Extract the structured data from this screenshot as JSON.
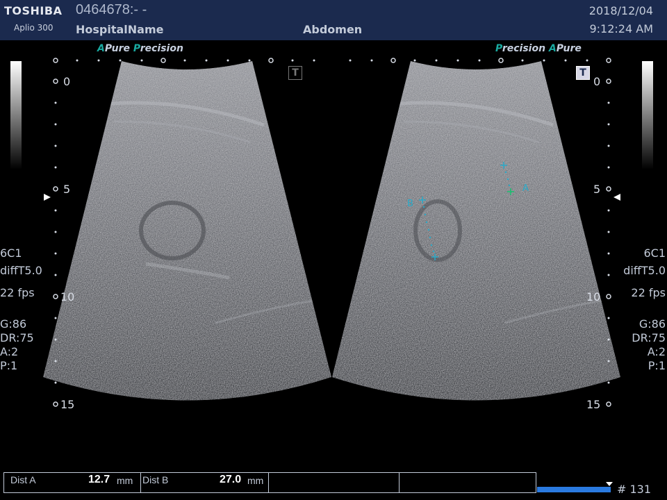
{
  "header": {
    "brand": "TOSHIBA",
    "model": "Aplio 300",
    "patient_id": "0464678:- -",
    "hospital": "HospitalName",
    "exam": "Abdomen",
    "date": "2018/12/04",
    "time": "9:12:24 AM"
  },
  "tags": {
    "left": {
      "a": "A",
      "pure": "Pure",
      "p": "P",
      "recision": "recision"
    },
    "right": {
      "p": "P",
      "recision": "recision",
      "a": "A",
      "pure": "Pure"
    }
  },
  "depth_scale": {
    "left": [
      "0",
      "5",
      "10",
      "15"
    ],
    "right": [
      "0",
      "5",
      "10",
      "15"
    ]
  },
  "side_info": {
    "left": {
      "probe": "6C1",
      "mode": "diffT5.0",
      "fps": "22 fps",
      "gain": "G:86",
      "dr": "DR:75",
      "a": "A:2",
      "p": "P:1"
    },
    "right": {
      "probe": "6C1",
      "mode": "diffT5.0",
      "fps": "22 fps",
      "gain": "G:86",
      "dr": "DR:75",
      "a": "A:2",
      "p": "P:1"
    }
  },
  "markers": {
    "a": "A",
    "b": "B"
  },
  "toggle": {
    "label": "T"
  },
  "measurements": [
    {
      "label": "Dist A",
      "value": "12.7",
      "unit": "mm"
    },
    {
      "label": "Dist B",
      "value": "27.0",
      "unit": "mm"
    }
  ],
  "cine": {
    "frame": "# 131",
    "progress": 1.0
  },
  "colors": {
    "header": "#1b2a4e",
    "accent": "#19a9a0",
    "caliper": "#2aa9c8"
  }
}
